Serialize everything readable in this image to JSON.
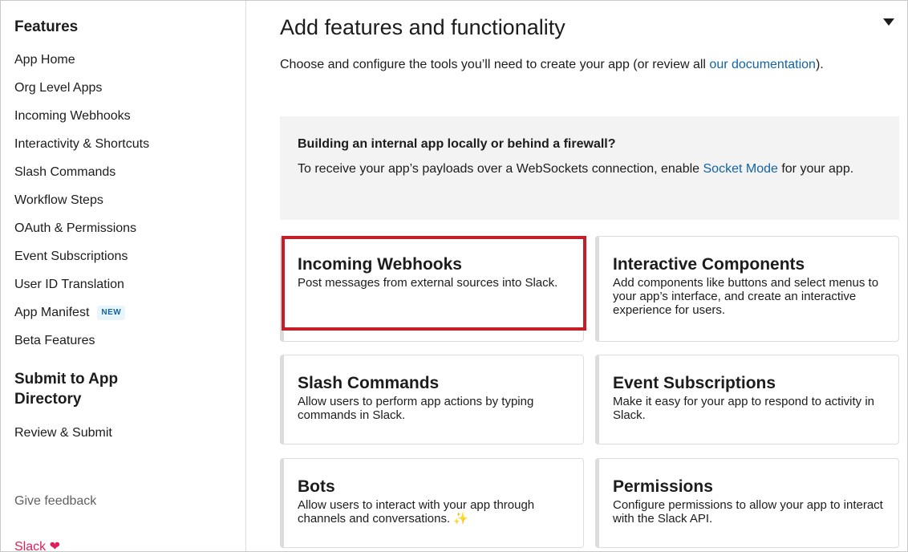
{
  "sidebar": {
    "heading": "Features",
    "items": [
      {
        "label": "App Home"
      },
      {
        "label": "Org Level Apps"
      },
      {
        "label": "Incoming Webhooks"
      },
      {
        "label": "Interactivity & Shortcuts"
      },
      {
        "label": "Slash Commands"
      },
      {
        "label": "Workflow Steps"
      },
      {
        "label": "OAuth & Permissions"
      },
      {
        "label": "Event Subscriptions"
      },
      {
        "label": "User ID Translation"
      },
      {
        "label": "App Manifest",
        "badge": "NEW"
      },
      {
        "label": "Beta Features"
      }
    ],
    "submit_heading": "Submit to App Directory",
    "submit_items": [
      {
        "label": "Review & Submit"
      }
    ],
    "feedback": "Give feedback",
    "footer": "Slack ❤"
  },
  "main": {
    "title": "Add features and functionality",
    "intro_text": "Choose and configure the tools you’ll need to create your app (or review all ",
    "intro_link": "our documentation",
    "intro_end": ").",
    "callout": {
      "title": "Building an internal app locally or behind a firewall?",
      "text": "To receive your app’s payloads over a WebSockets connection, enable ",
      "link": "Socket Mode",
      "text_end": " for your app."
    },
    "cards": [
      {
        "title": "Incoming Webhooks",
        "desc": "Post messages from external sources into Slack."
      },
      {
        "title": "Interactive Components",
        "desc": "Add components like buttons and select menus to your app’s interface, and create an interactive experience for users."
      },
      {
        "title": "Slash Commands",
        "desc": "Allow users to perform app actions by typing commands in Slack."
      },
      {
        "title": "Event Subscriptions",
        "desc": "Make it easy for your app to respond to activity in Slack."
      },
      {
        "title": "Bots",
        "desc": "Allow users to interact with your app through channels and conversations.",
        "emoji": "✨"
      },
      {
        "title": "Permissions",
        "desc": "Configure permissions to allow your app to interact with the Slack API."
      }
    ]
  },
  "colors": {
    "link": "#1264a3",
    "highlight": "#c41e28",
    "slack_red": "#e01e5a"
  }
}
